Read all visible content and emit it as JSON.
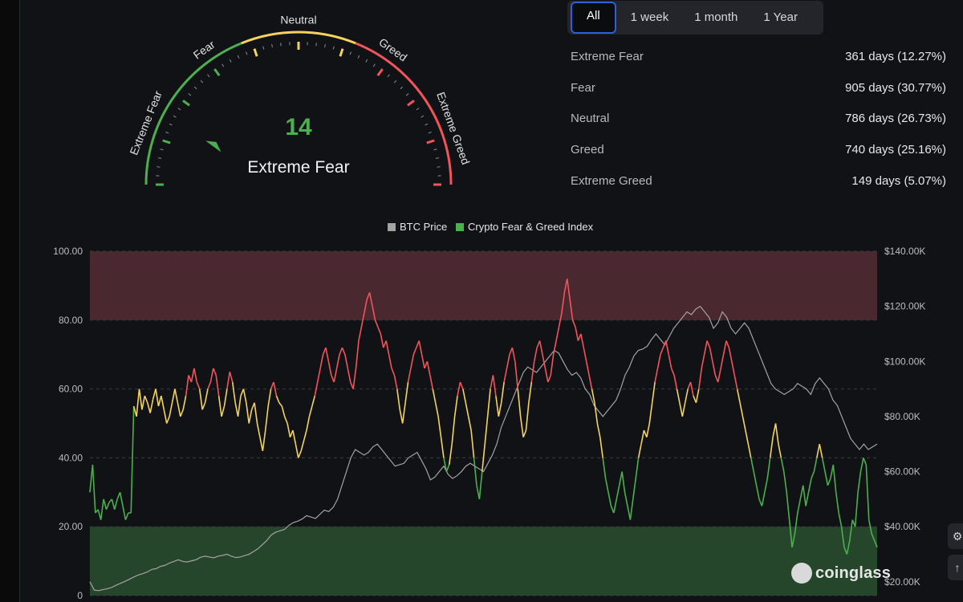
{
  "gauge": {
    "value": 14,
    "status": "Extreme Fear",
    "min": 0,
    "max": 100,
    "zone_labels": [
      "Extreme Fear",
      "Fear",
      "Neutral",
      "Greed",
      "Extreme Greed"
    ],
    "colors": {
      "green": "#4caf50",
      "yellow": "#f4d35e",
      "red": "#f2545b",
      "tick": "#8e8e8e"
    }
  },
  "tabs": [
    "All",
    "1 week",
    "1 month",
    "1 Year"
  ],
  "active_tab": "All",
  "stats": [
    {
      "label": "Extreme Fear",
      "value": "361 days (12.27%)"
    },
    {
      "label": "Fear",
      "value": "905 days (30.77%)"
    },
    {
      "label": "Neutral",
      "value": "786 days (26.73%)"
    },
    {
      "label": "Greed",
      "value": "740 days (25.16%)"
    },
    {
      "label": "Extreme Greed",
      "value": "149 days (5.07%)"
    }
  ],
  "watermark": "coinglass",
  "chart_data": {
    "type": "line",
    "legend": [
      "BTC Price",
      "Crypto Fear & Greed Index"
    ],
    "legend_colors": [
      "#a3a3a3",
      "#4caf50"
    ],
    "left_axis": {
      "ticks": [
        "0",
        "20.00",
        "40.00",
        "60.00",
        "80.00",
        "100.00"
      ],
      "range": [
        0,
        100
      ]
    },
    "right_axis": {
      "ticks": [
        "$20.00K",
        "$40.00K",
        "$60.00K",
        "$80.00K",
        "$100.00K",
        "$120.00K",
        "$140.00K"
      ],
      "range": [
        15000,
        140000
      ]
    },
    "bands": [
      {
        "from": 80,
        "to": 100,
        "color": "#4d2a30"
      },
      {
        "from": 0,
        "to": 20,
        "color": "#284a2c"
      }
    ],
    "thresholds": {
      "green_below": 40,
      "yellow_below": 60
    },
    "series": [
      {
        "name": "Crypto Fear & Greed Index",
        "axis": "left",
        "values": [
          30,
          38,
          24,
          25,
          22,
          28,
          25,
          27,
          28,
          25,
          28,
          30,
          26,
          22,
          24,
          24,
          55,
          52,
          60,
          54,
          58,
          56,
          53,
          57,
          60,
          55,
          58,
          54,
          50,
          52,
          56,
          60,
          56,
          52,
          54,
          58,
          64,
          62,
          66,
          62,
          60,
          54,
          56,
          60,
          62,
          66,
          64,
          58,
          52,
          55,
          60,
          65,
          62,
          56,
          52,
          58,
          60,
          56,
          50,
          54,
          56,
          50,
          46,
          42,
          48,
          55,
          60,
          62,
          58,
          56,
          55,
          52,
          50,
          46,
          48,
          44,
          40,
          42,
          45,
          48,
          52,
          55,
          58,
          62,
          66,
          70,
          72,
          68,
          64,
          62,
          66,
          70,
          72,
          70,
          66,
          62,
          60,
          66,
          74,
          78,
          82,
          86,
          88,
          84,
          80,
          78,
          76,
          72,
          74,
          70,
          66,
          64,
          60,
          54,
          50,
          56,
          62,
          66,
          70,
          72,
          74,
          70,
          66,
          68,
          64,
          60,
          56,
          52,
          46,
          40,
          36,
          38,
          44,
          52,
          58,
          62,
          60,
          56,
          52,
          48,
          40,
          32,
          28,
          36,
          44,
          52,
          60,
          64,
          58,
          52,
          56,
          62,
          66,
          70,
          72,
          68,
          60,
          52,
          46,
          48,
          56,
          62,
          68,
          72,
          74,
          70,
          66,
          62,
          64,
          70,
          74,
          78,
          82,
          88,
          92,
          86,
          80,
          78,
          74,
          76,
          72,
          68,
          64,
          60,
          56,
          50,
          46,
          40,
          34,
          30,
          26,
          24,
          28,
          32,
          36,
          30,
          26,
          22,
          28,
          34,
          40,
          44,
          48,
          46,
          50,
          56,
          62,
          66,
          70,
          72,
          74,
          70,
          66,
          64,
          60,
          56,
          52,
          56,
          60,
          62,
          58,
          56,
          60,
          66,
          70,
          74,
          72,
          68,
          64,
          62,
          66,
          70,
          74,
          72,
          68,
          64,
          60,
          56,
          52,
          48,
          44,
          40,
          36,
          32,
          28,
          26,
          30,
          34,
          40,
          46,
          50,
          44,
          40,
          36,
          30,
          22,
          14,
          18,
          24,
          28,
          32,
          26,
          30,
          34,
          36,
          40,
          44,
          40,
          36,
          32,
          34,
          38,
          30,
          24,
          20,
          14,
          12,
          16,
          22,
          20,
          30,
          36,
          40,
          38,
          22,
          18,
          16,
          14
        ]
      },
      {
        "name": "BTC Price",
        "axis": "right",
        "values": [
          20000,
          17000,
          16800,
          17200,
          17500,
          18000,
          18800,
          19500,
          20200,
          21000,
          21800,
          22500,
          23000,
          23600,
          24500,
          24800,
          25600,
          26000,
          26800,
          27400,
          28000,
          27400,
          27200,
          27600,
          28000,
          28900,
          29300,
          29000,
          28700,
          29300,
          29600,
          30000,
          29300,
          28800,
          29000,
          29500,
          30000,
          31000,
          32000,
          33500,
          35000,
          37000,
          38000,
          38500,
          39000,
          40500,
          41500,
          42000,
          42800,
          44000,
          43500,
          43000,
          44500,
          46000,
          45500,
          47000,
          50000,
          55000,
          60000,
          65000,
          68000,
          67000,
          66000,
          67000,
          69000,
          70000,
          68000,
          66000,
          64000,
          62000,
          62500,
          63000,
          65000,
          66000,
          67000,
          64000,
          61000,
          57000,
          58000,
          60000,
          62000,
          59000,
          57500,
          58500,
          60000,
          62000,
          63000,
          62000,
          61000,
          60000,
          63000,
          66000,
          70000,
          76000,
          80000,
          84000,
          88000,
          92000,
          96000,
          98000,
          97000,
          96000,
          98000,
          100000,
          102000,
          104000,
          103000,
          100000,
          97000,
          95000,
          96000,
          94000,
          90000,
          88000,
          84000,
          82000,
          80000,
          82000,
          84000,
          86000,
          90000,
          95000,
          98000,
          102000,
          104000,
          104500,
          105500,
          108000,
          110000,
          108000,
          106000,
          109000,
          112000,
          114000,
          116000,
          118000,
          117000,
          119000,
          120000,
          118000,
          116000,
          112000,
          114000,
          118000,
          116000,
          112000,
          110000,
          112000,
          114000,
          112000,
          108000,
          104000,
          100000,
          96000,
          92000,
          90000,
          89000,
          88000,
          89000,
          90000,
          92000,
          91000,
          90000,
          88000,
          92000,
          94000,
          92000,
          90000,
          86000,
          84000,
          80000,
          76000,
          72000,
          70000,
          68000,
          70000,
          68000,
          69000,
          70000
        ]
      }
    ]
  }
}
